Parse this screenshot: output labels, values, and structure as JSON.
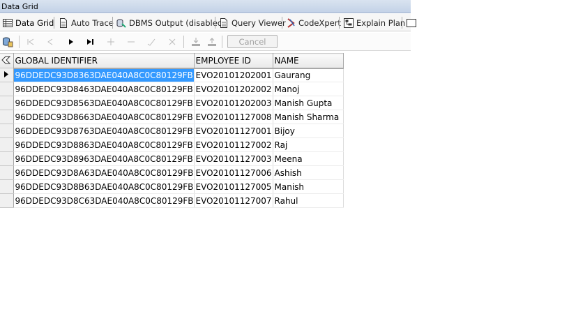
{
  "panel": {
    "title": "Data Grid"
  },
  "tabs": [
    {
      "label": "Data Grid",
      "icon": "grid-icon"
    },
    {
      "label": "Auto Trace",
      "icon": "document-icon"
    },
    {
      "label": "DBMS Output (disabled)",
      "icon": "dbms-icon"
    },
    {
      "label": "Query Viewer",
      "icon": "document-icon"
    },
    {
      "label": "CodeXpert",
      "icon": "codexpert-icon"
    },
    {
      "label": "Explain Plan",
      "icon": "explain-plan-icon"
    }
  ],
  "toolbar": {
    "cancel_label": "Cancel",
    "buttons": [
      "database-export-icon",
      "first-record-icon",
      "prior-record-icon",
      "next-record-icon",
      "last-record-icon",
      "insert-record-icon",
      "delete-record-icon",
      "edit-record-icon",
      "post-edit-icon",
      "cancel-edit-icon",
      "download-icon",
      "upload-icon"
    ]
  },
  "grid": {
    "columns": [
      "GLOBAL IDENTIFIER",
      "EMPLOYEE ID",
      "NAME"
    ],
    "rows": [
      [
        "96DDEDC93D8363DAE040A8C0C80129FB",
        "EVO20101202001",
        "Gaurang"
      ],
      [
        "96DDEDC93D8463DAE040A8C0C80129FB",
        "EVO20101202002",
        "Manoj"
      ],
      [
        "96DDEDC93D8563DAE040A8C0C80129FB",
        "EVO20101202003",
        "Manish Gupta"
      ],
      [
        "96DDEDC93D8663DAE040A8C0C80129FB",
        "EVO20101127008",
        "Manish Sharma"
      ],
      [
        "96DDEDC93D8763DAE040A8C0C80129FB",
        "EVO20101127001",
        "Bijoy"
      ],
      [
        "96DDEDC93D8863DAE040A8C0C80129FB",
        "EVO20101127002",
        "Raj"
      ],
      [
        "96DDEDC93D8963DAE040A8C0C80129FB",
        "EVO20101127003",
        "Meena"
      ],
      [
        "96DDEDC93D8A63DAE040A8C0C80129FB",
        "EVO20101127006",
        "Ashish"
      ],
      [
        "96DDEDC93D8B63DAE040A8C0C80129FB",
        "EVO20101127005",
        "Manish"
      ],
      [
        "96DDEDC93D8C63DAE040A8C0C80129FB",
        "EVO20101127007",
        "Rahul"
      ]
    ],
    "selection_color": "#3399ff"
  }
}
